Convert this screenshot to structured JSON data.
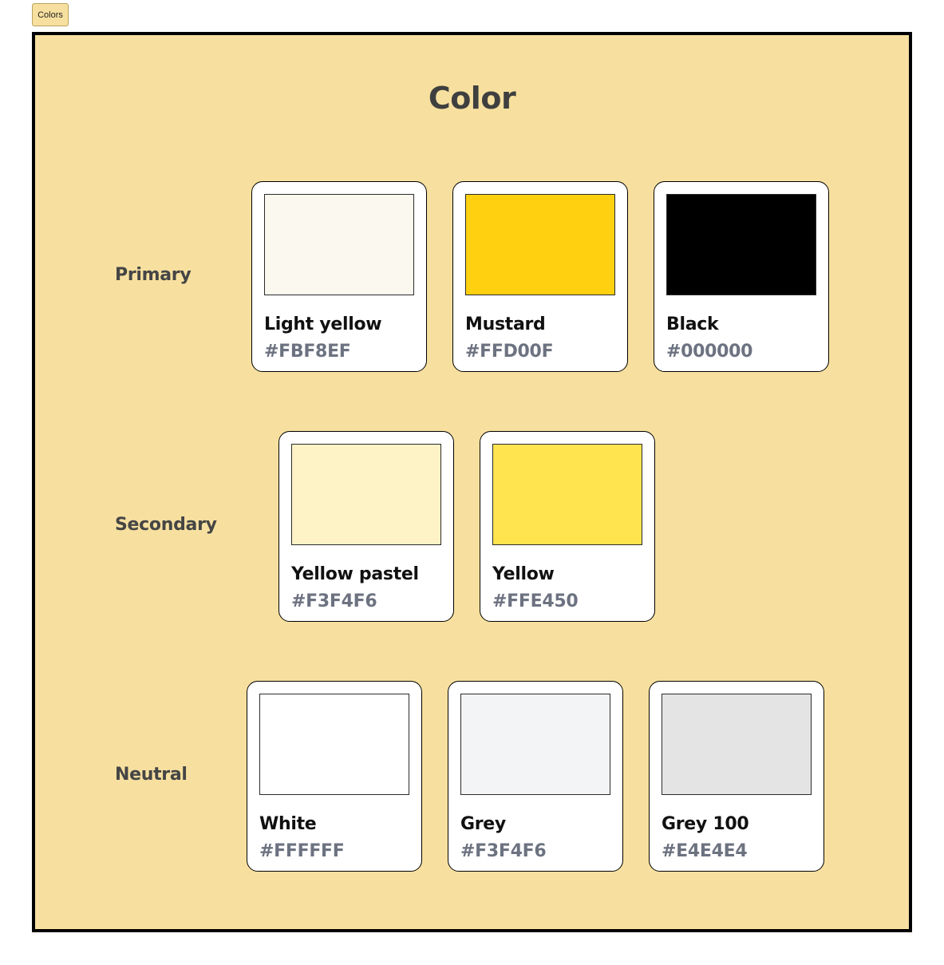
{
  "frame": {
    "tab_label": "Colors"
  },
  "board": {
    "title": "Color"
  },
  "groups": {
    "primary": {
      "label": "Primary",
      "swatches": [
        {
          "name": "Light yellow",
          "hex": "#FBF8EF",
          "color": "#FBF8EF"
        },
        {
          "name": "Mustard",
          "hex": "#FFD00F",
          "color": "#FFD00F"
        },
        {
          "name": "Black",
          "hex": "#000000",
          "color": "#000000"
        }
      ]
    },
    "secondary": {
      "label": "Secondary",
      "swatches": [
        {
          "name": "Yellow pastel",
          "hex": "#F3F4F6",
          "color": "#FEF3C7"
        },
        {
          "name": "Yellow",
          "hex": "#FFE450",
          "color": "#FFE450"
        }
      ]
    },
    "neutral": {
      "label": "Neutral",
      "swatches": [
        {
          "name": "White",
          "hex": "#FFFFFF",
          "color": "#FFFFFF"
        },
        {
          "name": "Grey",
          "hex": "#F3F4F6",
          "color": "#F3F4F6"
        },
        {
          "name": "Grey 100",
          "hex": "#E4E4E4",
          "color": "#E4E4E4"
        }
      ]
    }
  },
  "colors": {
    "board_background": "#F7E09F",
    "label_text": "#454545",
    "hex_text": "#6C7280"
  }
}
